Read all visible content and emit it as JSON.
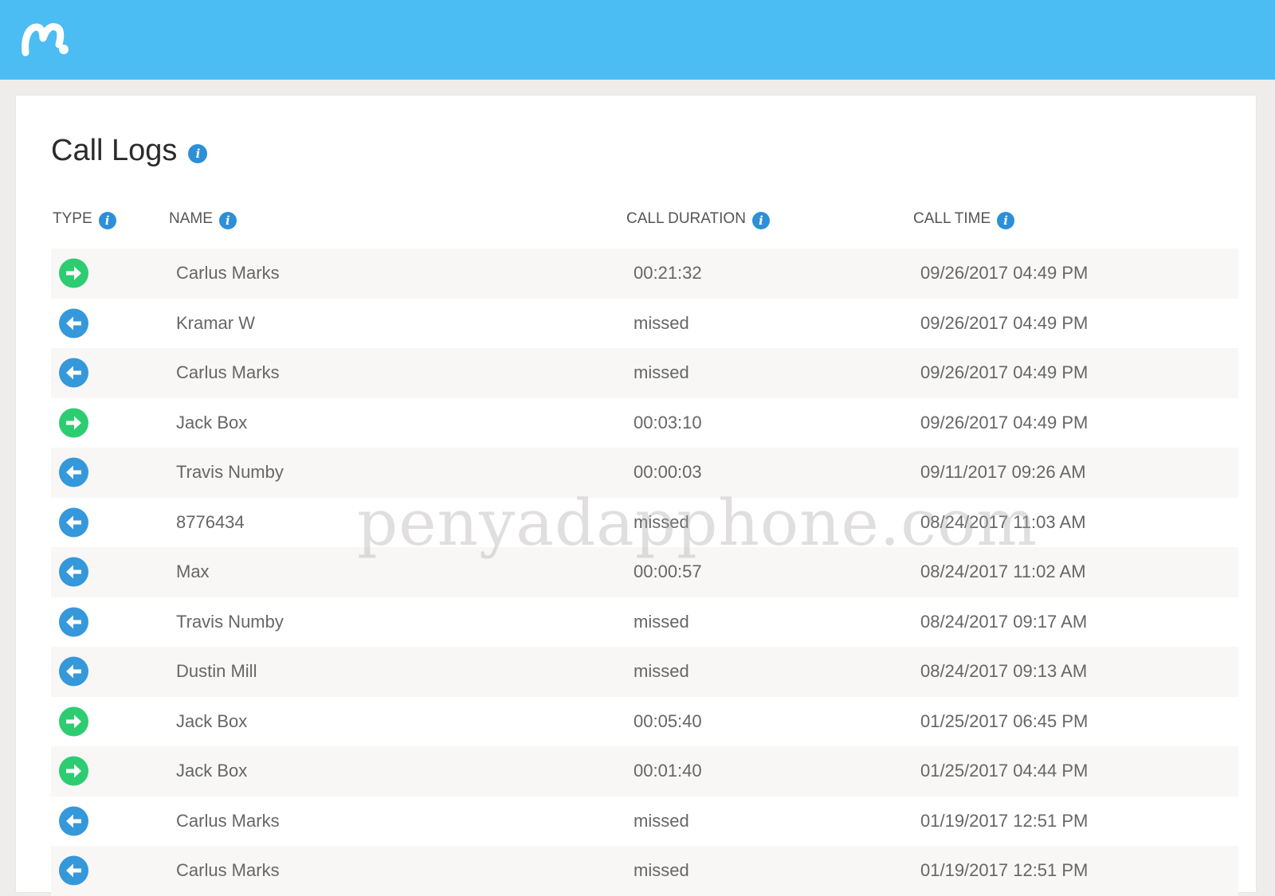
{
  "app": {
    "logo_icon": "mspy-m-logo-icon",
    "brand_color": "#4bbdf2"
  },
  "page": {
    "title": "Call Logs"
  },
  "columns": {
    "type": "TYPE",
    "name": "NAME",
    "duration": "CALL DURATION",
    "time": "CALL TIME"
  },
  "rows": [
    {
      "type": "outgoing",
      "name": "Carlus Marks",
      "duration": "00:21:32",
      "time": "09/26/2017 04:49 PM"
    },
    {
      "type": "incoming",
      "name": "Kramar W",
      "duration": "missed",
      "time": "09/26/2017 04:49 PM"
    },
    {
      "type": "incoming",
      "name": "Carlus Marks",
      "duration": "missed",
      "time": "09/26/2017 04:49 PM"
    },
    {
      "type": "outgoing",
      "name": "Jack Box",
      "duration": "00:03:10",
      "time": "09/26/2017 04:49 PM"
    },
    {
      "type": "incoming",
      "name": "Travis Numby",
      "duration": "00:00:03",
      "time": "09/11/2017 09:26 AM"
    },
    {
      "type": "incoming",
      "name": "8776434",
      "duration": "missed",
      "time": "08/24/2017 11:03 AM"
    },
    {
      "type": "incoming",
      "name": "Max",
      "duration": "00:00:57",
      "time": "08/24/2017 11:02 AM"
    },
    {
      "type": "incoming",
      "name": "Travis Numby",
      "duration": "missed",
      "time": "08/24/2017 09:17 AM"
    },
    {
      "type": "incoming",
      "name": "Dustin Mill",
      "duration": "missed",
      "time": "08/24/2017 09:13 AM"
    },
    {
      "type": "outgoing",
      "name": "Jack Box",
      "duration": "00:05:40",
      "time": "01/25/2017 06:45 PM"
    },
    {
      "type": "outgoing",
      "name": "Jack Box",
      "duration": "00:01:40",
      "time": "01/25/2017 04:44 PM"
    },
    {
      "type": "incoming",
      "name": "Carlus Marks",
      "duration": "missed",
      "time": "01/19/2017 12:51 PM"
    },
    {
      "type": "incoming",
      "name": "Carlus Marks",
      "duration": "missed",
      "time": "01/19/2017 12:51 PM"
    }
  ],
  "colors": {
    "outgoing": "#2ecc71",
    "incoming": "#3498db",
    "info": "#2c8fd8"
  },
  "watermark": "penyadapphone.com"
}
